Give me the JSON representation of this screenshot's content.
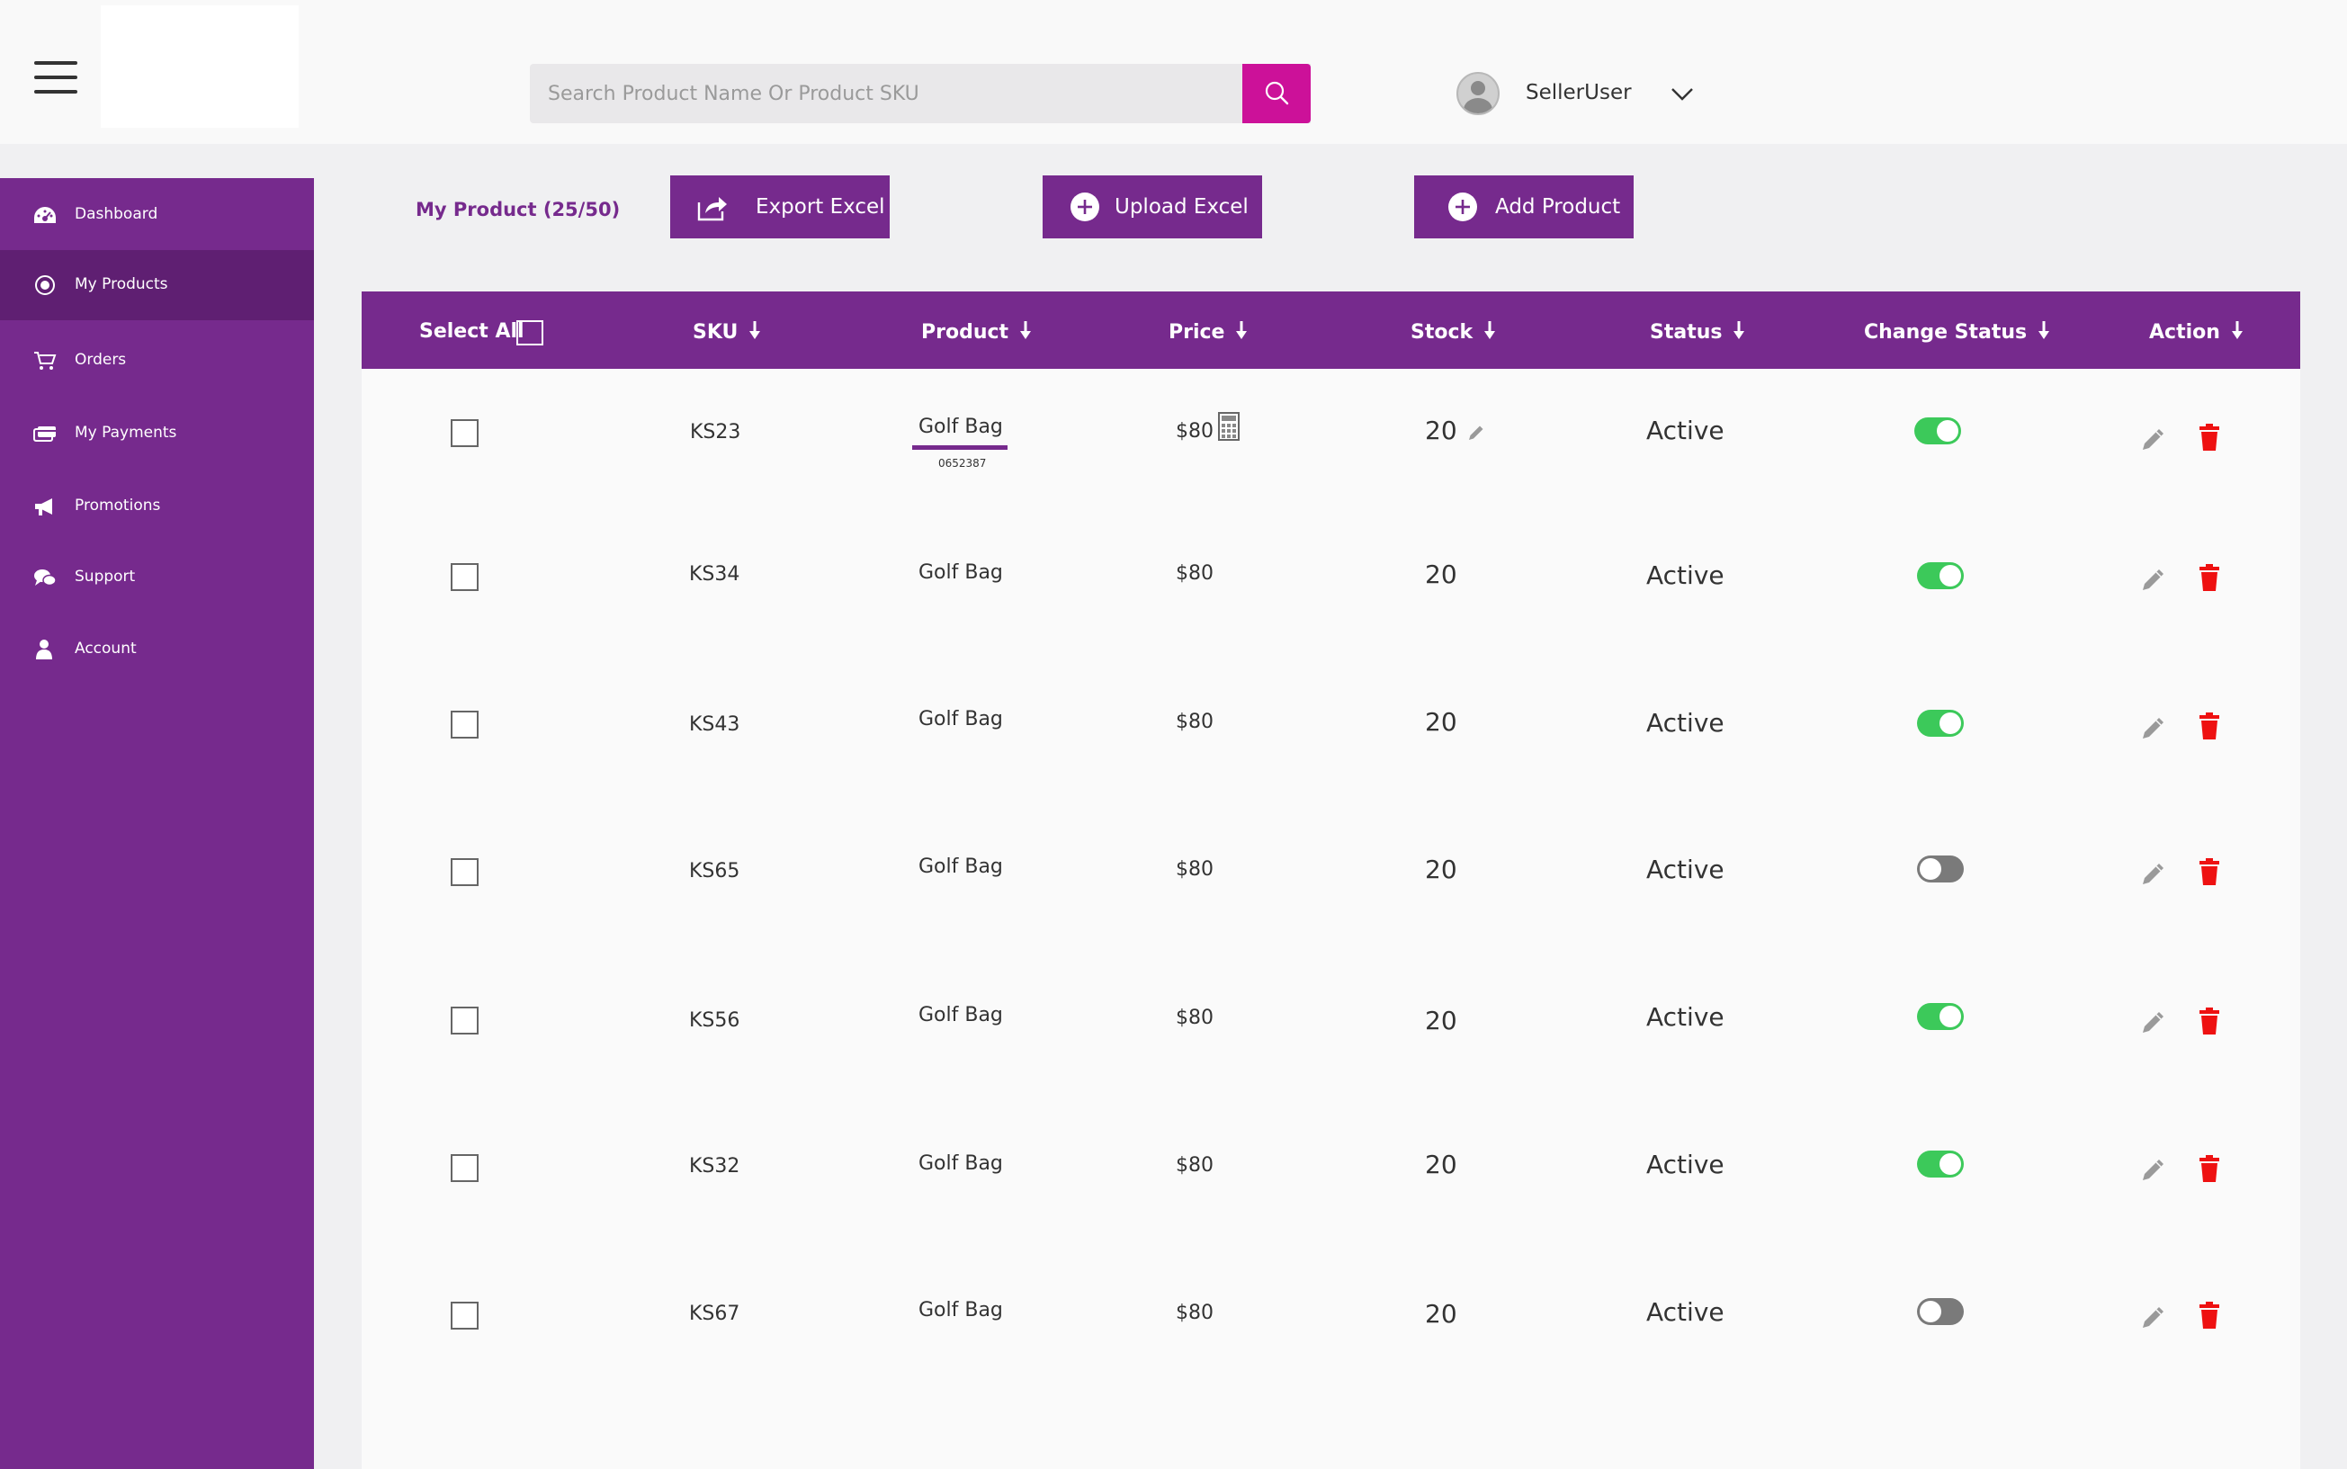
{
  "header": {
    "search_placeholder": "Search Product Name Or Product SKU",
    "user_name": "SellerUser",
    "search_button_color": "#cc1199"
  },
  "sidebar": {
    "color": "#762a8d",
    "items": [
      {
        "label": "Dashboard",
        "icon": "dashboard-icon"
      },
      {
        "label": "My Products",
        "icon": "products-icon",
        "active": true
      },
      {
        "label": "Orders",
        "icon": "cart-icon"
      },
      {
        "label": "My Payments",
        "icon": "payments-icon"
      },
      {
        "label": "Promotions",
        "icon": "megaphone-icon"
      },
      {
        "label": "Support",
        "icon": "chat-icon"
      },
      {
        "label": "Account",
        "icon": "user-icon"
      }
    ]
  },
  "toolbar": {
    "title": "My Product (25/50)",
    "export_label": "Export Excel",
    "upload_label": "Upload Excel",
    "add_label": "Add Product"
  },
  "table": {
    "headers": {
      "select_all": "Select All",
      "sku": "SKU",
      "product": "Product",
      "price": "Price",
      "stock": "Stock",
      "status": "Status",
      "change_status": "Change Status",
      "action": "Action"
    },
    "rows": [
      {
        "sku": "KS23",
        "product": "Golf Bag",
        "product_code": "0652387",
        "price": "$80",
        "stock": "20",
        "status": "Active",
        "enabled": true
      },
      {
        "sku": "KS34",
        "product": "Golf Bag",
        "price": "$80",
        "stock": "20",
        "status": "Active",
        "enabled": true
      },
      {
        "sku": "KS43",
        "product": "Golf Bag",
        "price": "$80",
        "stock": "20",
        "status": "Active",
        "enabled": true
      },
      {
        "sku": "KS65",
        "product": "Golf Bag",
        "price": "$80",
        "stock": "20",
        "status": "Active",
        "enabled": false
      },
      {
        "sku": "KS56",
        "product": "Golf Bag",
        "price": "$80",
        "stock": "20",
        "status": "Active",
        "enabled": true
      },
      {
        "sku": "KS32",
        "product": "Golf Bag",
        "price": "$80",
        "stock": "20",
        "status": "Active",
        "enabled": true
      },
      {
        "sku": "KS67",
        "product": "Golf Bag",
        "price": "$80",
        "stock": "20",
        "status": "Active",
        "enabled": false
      }
    ]
  },
  "colors": {
    "brand": "#762a8d",
    "toggle_on": "#3cc95a",
    "toggle_off": "#7a7a7a",
    "delete": "#ee1111"
  }
}
